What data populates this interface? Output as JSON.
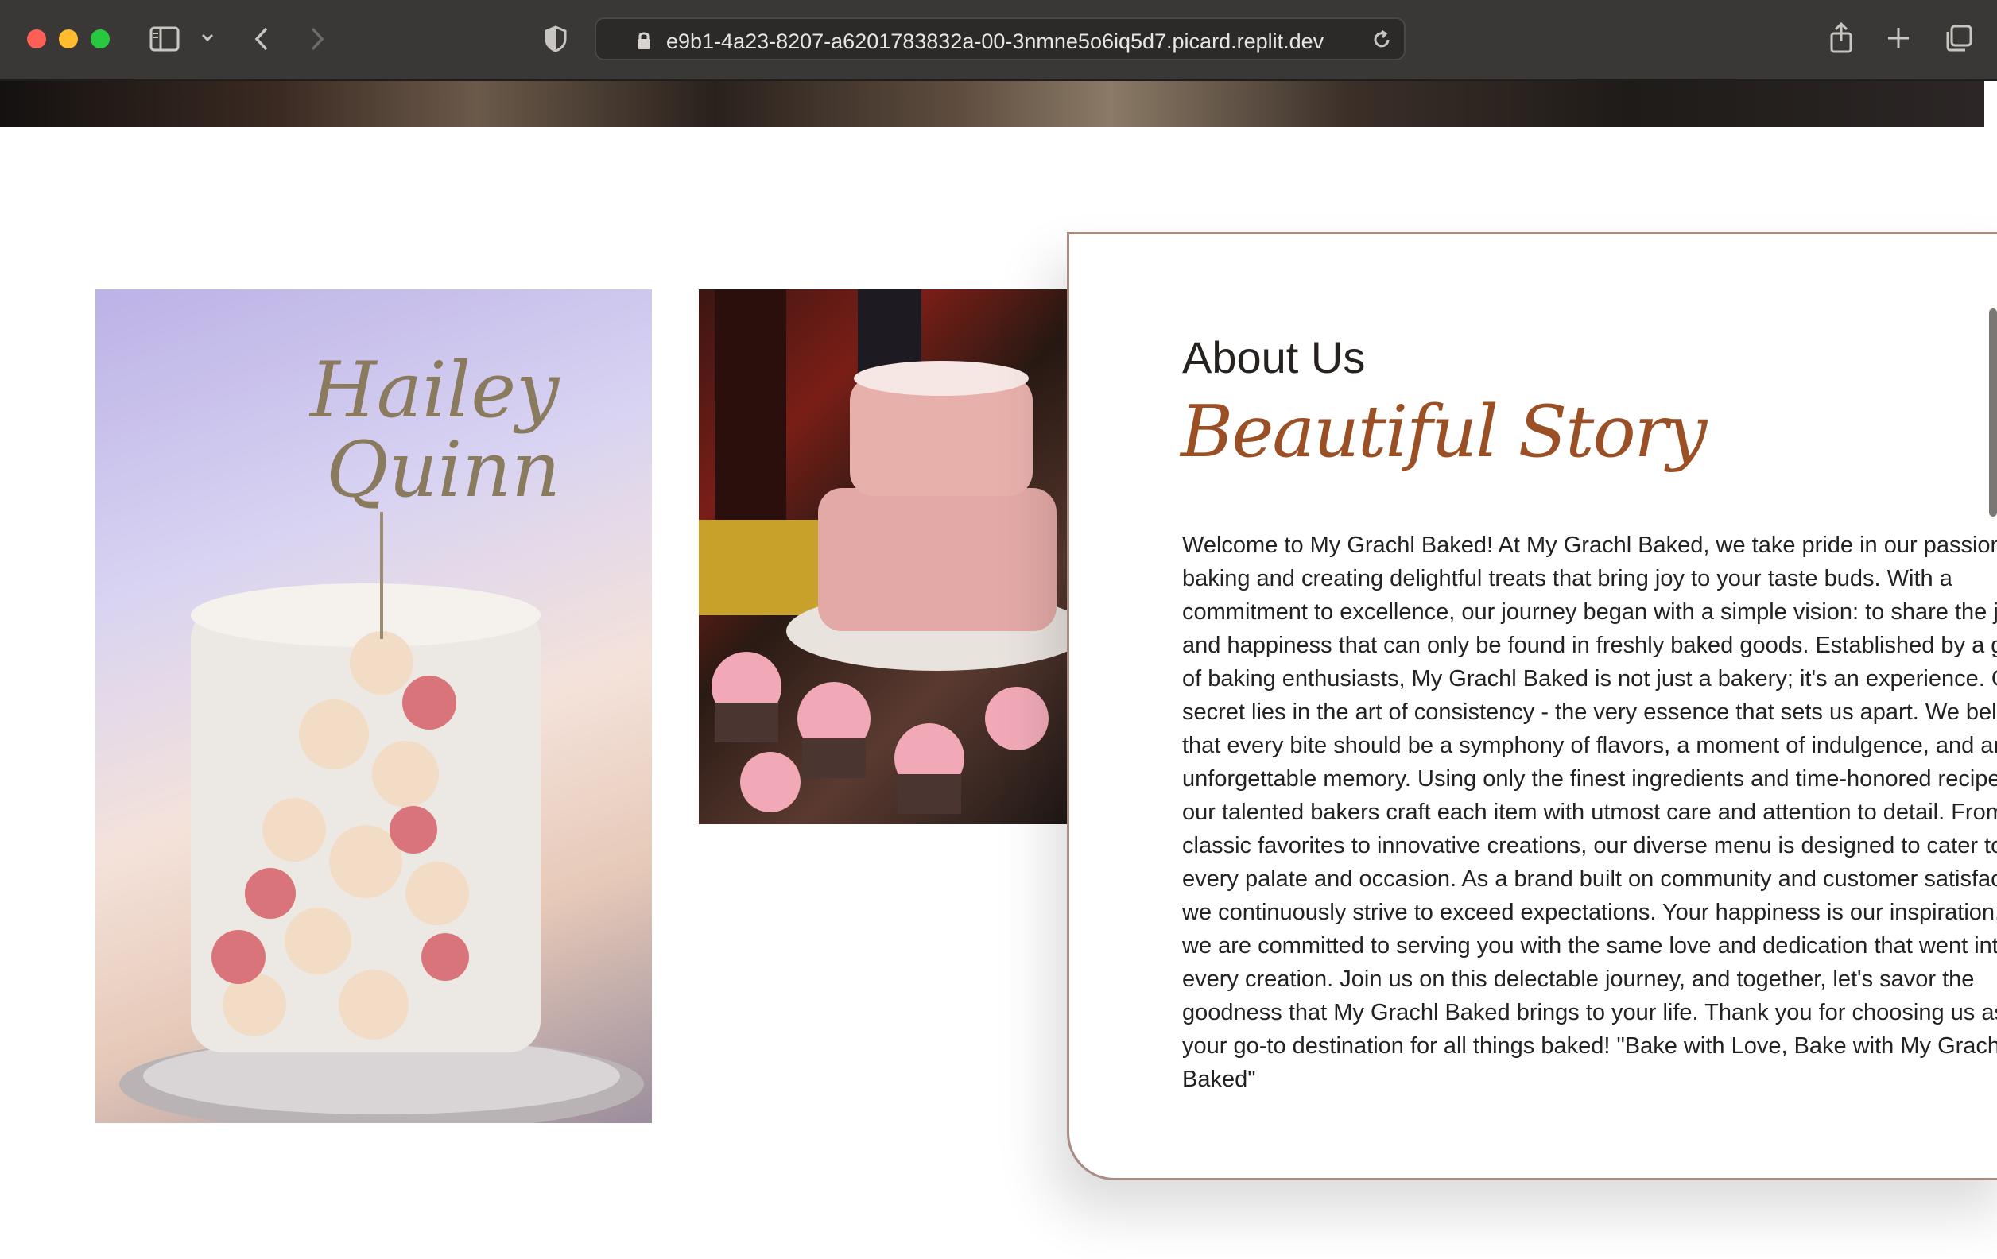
{
  "browser": {
    "url": "e9b1-4a23-8207-a6201783832a-00-3nmne5o6iq5d7.picard.replit.dev",
    "icons": [
      "sidebar-icon",
      "chevron-down-icon",
      "back-icon",
      "forward-icon",
      "privacy-shield-icon",
      "lock-icon",
      "reload-icon",
      "share-icon",
      "new-tab-icon",
      "tab-overview-icon"
    ]
  },
  "about": {
    "title": "About Us",
    "subtitle": "Beautiful Story",
    "body": "Welcome to My Grachl Baked! At My Grachl Baked, we take pride in our passion for baking and creating delightful treats that bring joy to your taste buds. With a commitment to excellence, our journey began with a simple vision: to share the joy and happiness that can only be found in freshly baked goods. Established by a group of baking enthusiasts, My Grachl Baked is not just a bakery; it's an experience. Our secret lies in the art of consistency - the very essence that sets us apart. We believe that every bite should be a symphony of flavors, a moment of indulgence, and an unforgettable memory. Using only the finest ingredients and time-honored recipes, our talented bakers craft each item with utmost care and attention to detail. From classic favorites to innovative creations, our diverse menu is designed to cater to every palate and occasion. As a brand built on community and customer satisfaction, we continuously strive to exceed expectations. Your happiness is our inspiration, and we are committed to serving you with the same love and dedication that went into every creation. Join us on this delectable journey, and together, let's savor the goodness that My Grachl Baked brings to your life. Thank you for choosing us as your go-to destination for all things baked! \"Bake with Love, Bake with My Grachl Baked\""
  },
  "colors": {
    "accent": "#9b4f24",
    "card_border": "#a88c84",
    "chrome": "#3a3836"
  }
}
